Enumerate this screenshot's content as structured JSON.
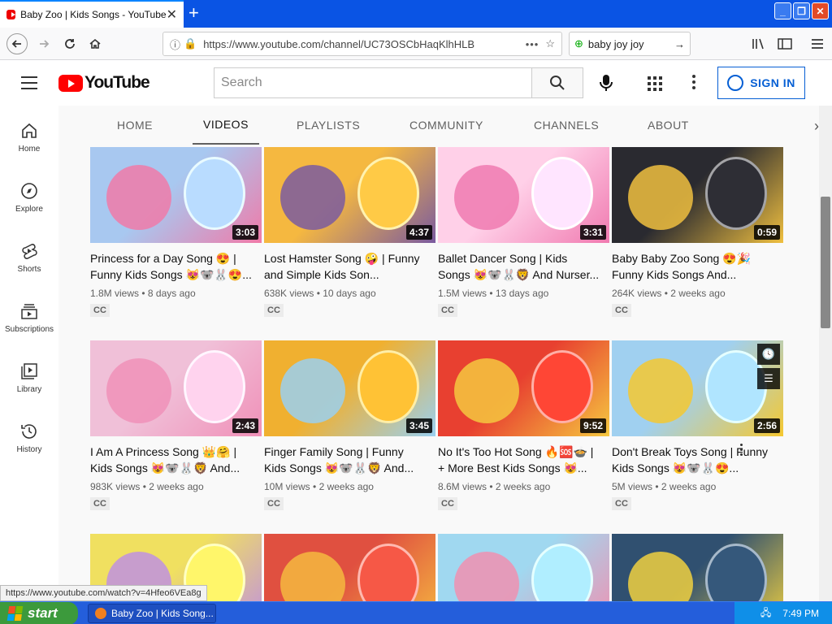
{
  "browser": {
    "tab_title": "Baby Zoo | Kids Songs - YouTube",
    "tab_close": "✕",
    "new_tab": "+",
    "url": "https://www.youtube.com/channel/UC73OSCbHaqKlhHLB",
    "url_dots": "•••",
    "search_value": "baby joy joy",
    "status_url": "https://www.youtube.com/watch?v=4Hfeo6VEa8g"
  },
  "youtube": {
    "logo_text": "YouTube",
    "search_placeholder": "Search",
    "sign_in": "SIGN IN"
  },
  "sidebar": {
    "items": [
      {
        "label": "Home",
        "icon": "home-icon"
      },
      {
        "label": "Explore",
        "icon": "compass-icon"
      },
      {
        "label": "Shorts",
        "icon": "shorts-icon"
      },
      {
        "label": "Subscriptions",
        "icon": "subscriptions-icon"
      },
      {
        "label": "Library",
        "icon": "library-icon"
      },
      {
        "label": "History",
        "icon": "history-icon"
      }
    ]
  },
  "channel_tabs": [
    "HOME",
    "VIDEOS",
    "PLAYLISTS",
    "COMMUNITY",
    "CHANNELS",
    "ABOUT"
  ],
  "videos": [
    {
      "title": "Princess for a Day Song 😍 | Funny Kids Songs 😻🐨🐰😍...",
      "duration": "3:03",
      "views": "1.8M views",
      "age": "8 days ago",
      "cc": "CC"
    },
    {
      "title": "Lost Hamster Song 🤪 | Funny and Simple Kids Son...",
      "duration": "4:37",
      "views": "638K views",
      "age": "10 days ago",
      "cc": "CC"
    },
    {
      "title": "Ballet Dancer Song | Kids Songs 😻🐨🐰🦁 And Nurser...",
      "duration": "3:31",
      "views": "1.5M views",
      "age": "13 days ago",
      "cc": "CC"
    },
    {
      "title": "Baby Baby Zoo Song 😍🎉 Funny Kids Songs And...",
      "duration": "0:59",
      "views": "264K views",
      "age": "2 weeks ago",
      "cc": "CC"
    },
    {
      "title": "I Am A Princess Song 👑🤗 | Kids Songs 😻🐨🐰🦁 And...",
      "duration": "2:43",
      "views": "983K views",
      "age": "2 weeks ago",
      "cc": "CC"
    },
    {
      "title": "Finger Family Song | Funny Kids Songs 😻🐨🐰🦁 And...",
      "duration": "3:45",
      "views": "10M views",
      "age": "2 weeks ago",
      "cc": "CC"
    },
    {
      "title": "No It's Too Hot Song 🔥🆘🍲 | + More Best Kids Songs 😻...",
      "duration": "9:52",
      "views": "8.6M views",
      "age": "2 weeks ago",
      "cc": "CC"
    },
    {
      "title": "Don't Break Toys Song | Funny Kids Songs 😻🐨🐰😍...",
      "duration": "2:56",
      "views": "5M views",
      "age": "2 weeks ago",
      "cc": "CC"
    },
    {
      "title": "",
      "duration": "",
      "views": "",
      "age": "",
      "cc": ""
    },
    {
      "title": "",
      "duration": "",
      "views": "",
      "age": "",
      "cc": ""
    },
    {
      "title": "",
      "duration": "",
      "views": "",
      "age": "",
      "cc": ""
    },
    {
      "title": "",
      "duration": "",
      "views": "",
      "age": "",
      "cc": ""
    }
  ],
  "thumb_colors": [
    [
      "#a8c8f0",
      "#f07aa8"
    ],
    [
      "#f5b840",
      "#7a5aa0"
    ],
    [
      "#ffd0e8",
      "#f07ab0"
    ],
    [
      "#2a2a30",
      "#f0c040"
    ],
    [
      "#f0c0d8",
      "#f090b8"
    ],
    [
      "#f0b030",
      "#9ad0f0"
    ],
    [
      "#e84030",
      "#f5c840"
    ],
    [
      "#a0d0f0",
      "#f5c830"
    ],
    [
      "#f0e060",
      "#c090e0"
    ],
    [
      "#e05040",
      "#f5b840"
    ],
    [
      "#a0d8f0",
      "#f090b0"
    ],
    [
      "#305070",
      "#f0d040"
    ]
  ],
  "taskbar": {
    "start": "start",
    "task": "Baby Zoo | Kids Song...",
    "clock": "7:49 PM"
  }
}
